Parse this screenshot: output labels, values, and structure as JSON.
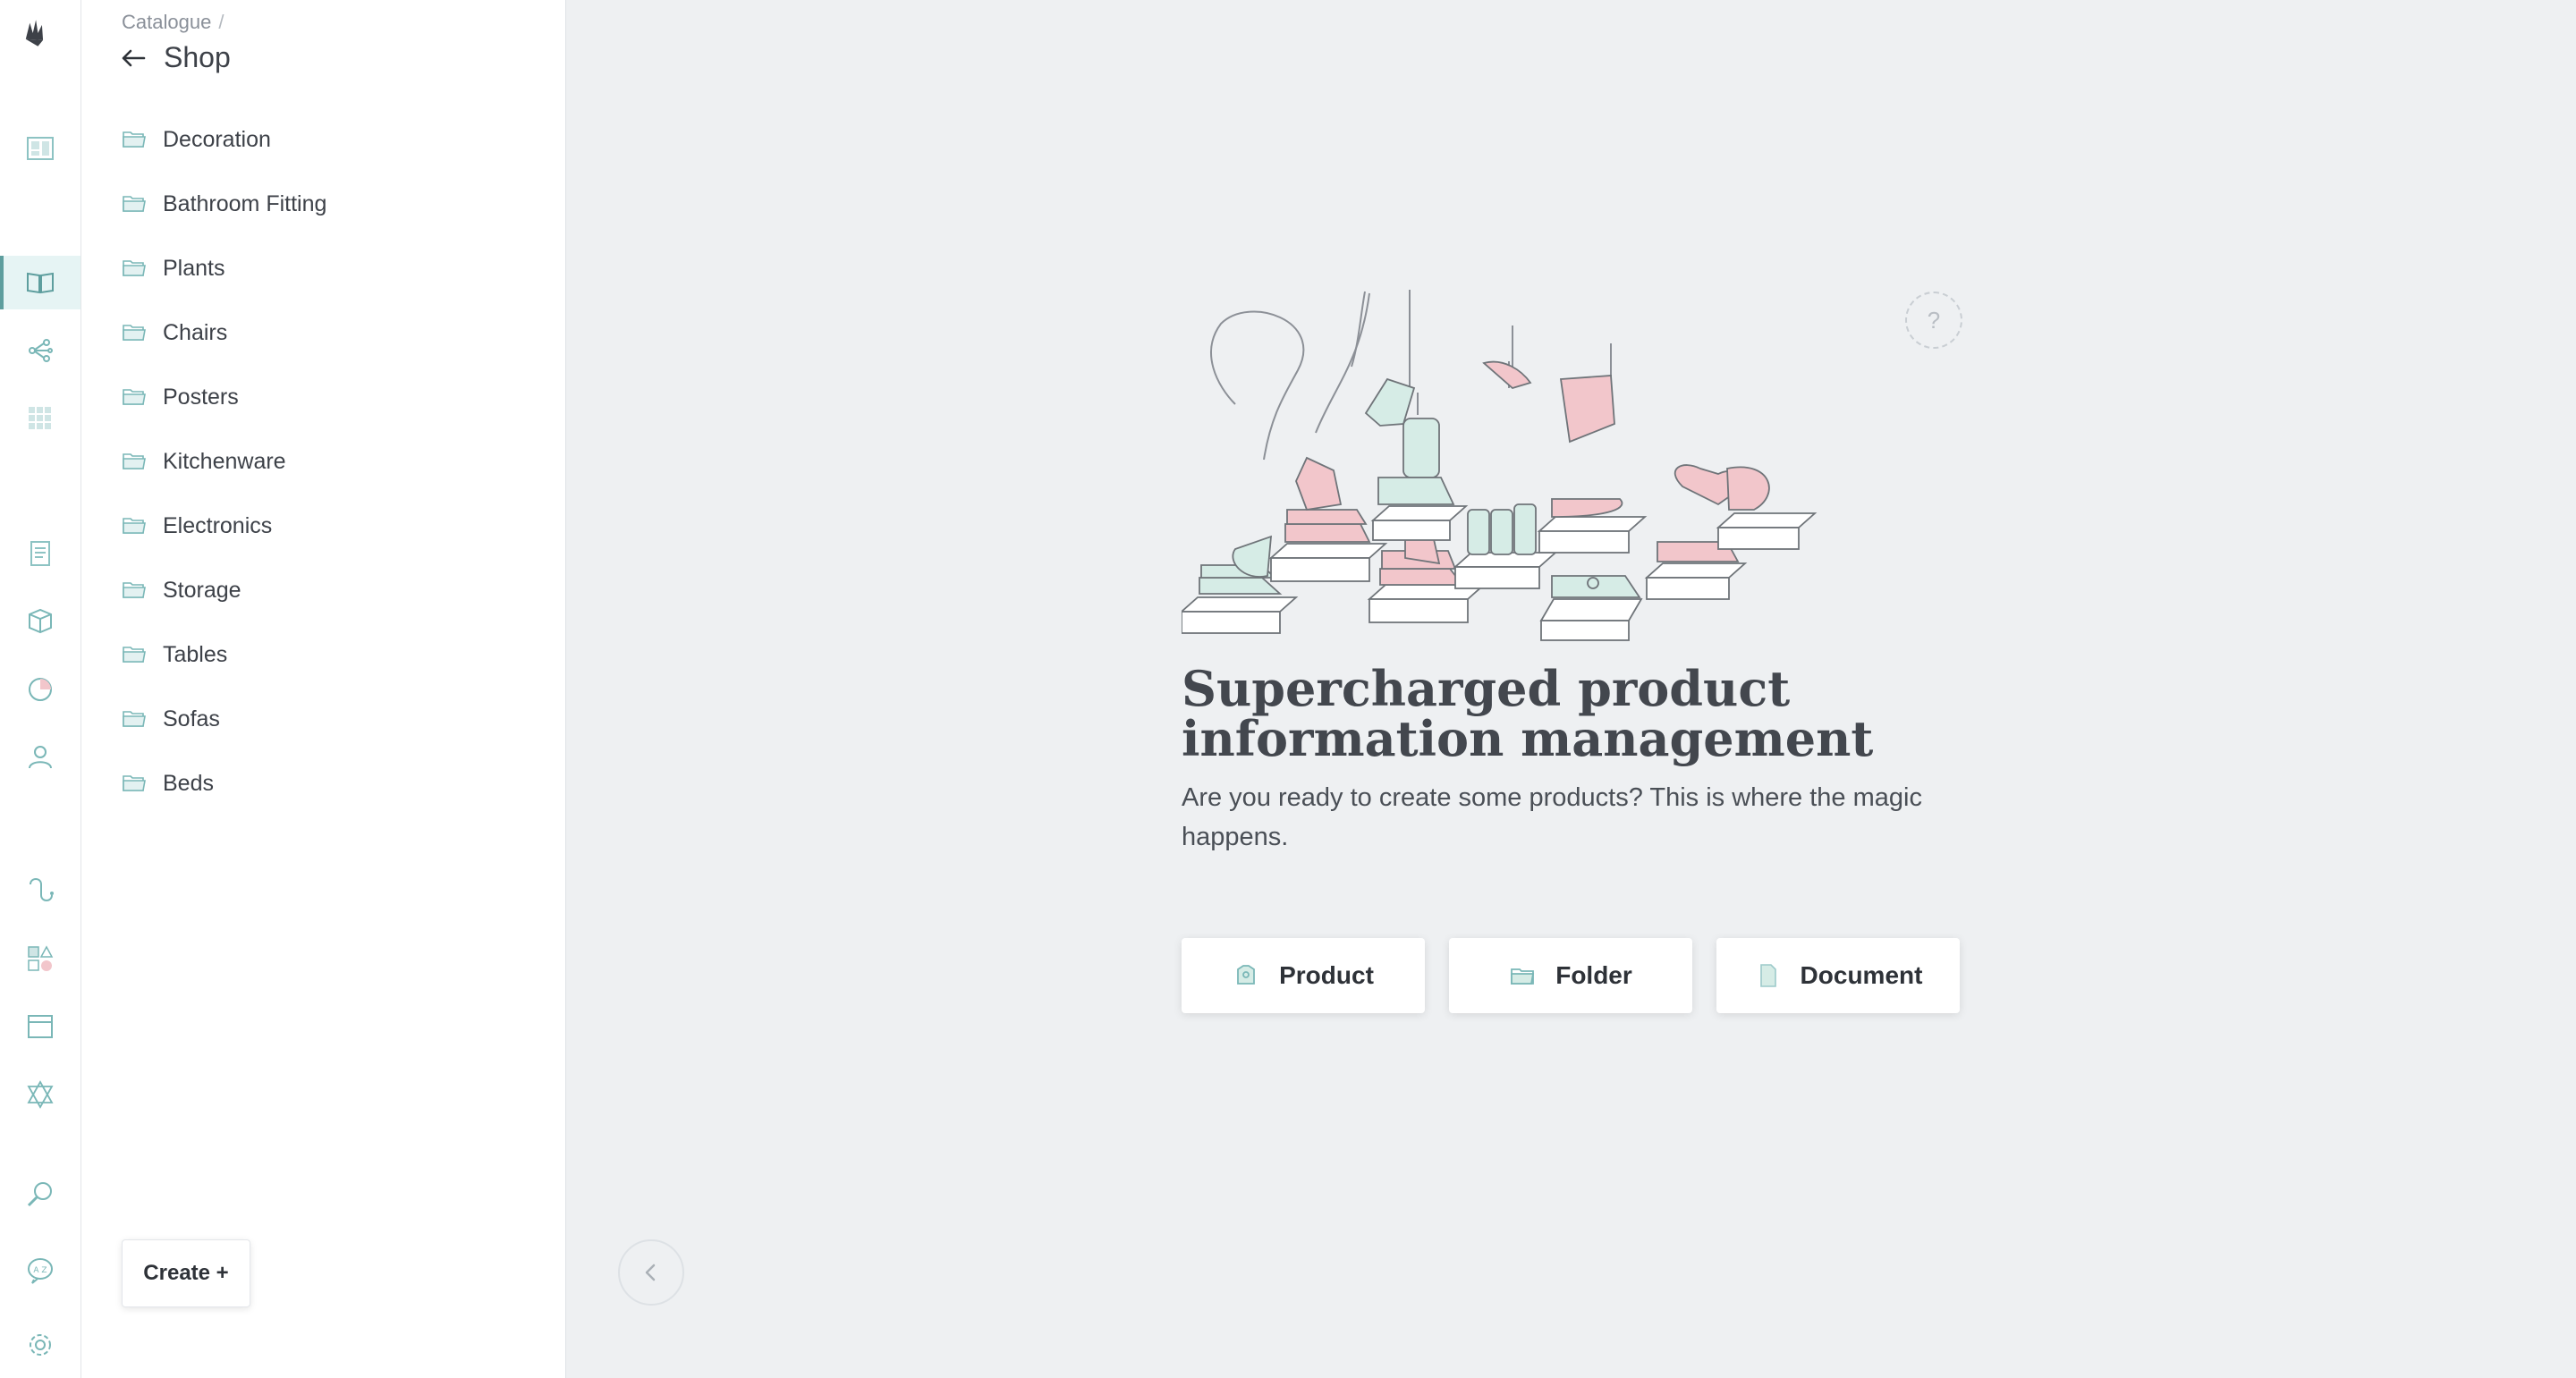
{
  "breadcrumb": {
    "parent": "Catalogue",
    "separator": "/"
  },
  "panel": {
    "title": "Shop"
  },
  "tree": [
    {
      "label": "Decoration"
    },
    {
      "label": "Bathroom Fitting"
    },
    {
      "label": "Plants"
    },
    {
      "label": "Chairs"
    },
    {
      "label": "Posters"
    },
    {
      "label": "Kitchenware"
    },
    {
      "label": "Electronics"
    },
    {
      "label": "Storage"
    },
    {
      "label": "Tables"
    },
    {
      "label": "Sofas"
    },
    {
      "label": "Beds"
    }
  ],
  "rail": {
    "icons": [
      "logo-icon",
      "dashboard-icon",
      "catalogue-icon",
      "flow-icon",
      "grid-icon",
      "clipboard-icon",
      "box-icon",
      "pie-chart-icon",
      "user-icon",
      "hook-icon",
      "shapes-icon",
      "layout-icon",
      "triangle-icon",
      "search-icon",
      "translate-icon",
      "gear-icon"
    ],
    "active": "catalogue-icon"
  },
  "create_button": {
    "label": "Create +"
  },
  "help": {
    "label": "?"
  },
  "empty_state": {
    "headline": "Supercharged product information management",
    "subline": "Are you ready to create some products? This is where the magic happens.",
    "actions": [
      {
        "label": "Product",
        "icon": "product-icon"
      },
      {
        "label": "Folder",
        "icon": "folder-icon"
      },
      {
        "label": "Document",
        "icon": "document-icon"
      }
    ]
  },
  "colors": {
    "accent": "#5e9e9e",
    "pink": "#f2c6cb",
    "mint": "#d6ece6",
    "background": "#eef0f2"
  }
}
